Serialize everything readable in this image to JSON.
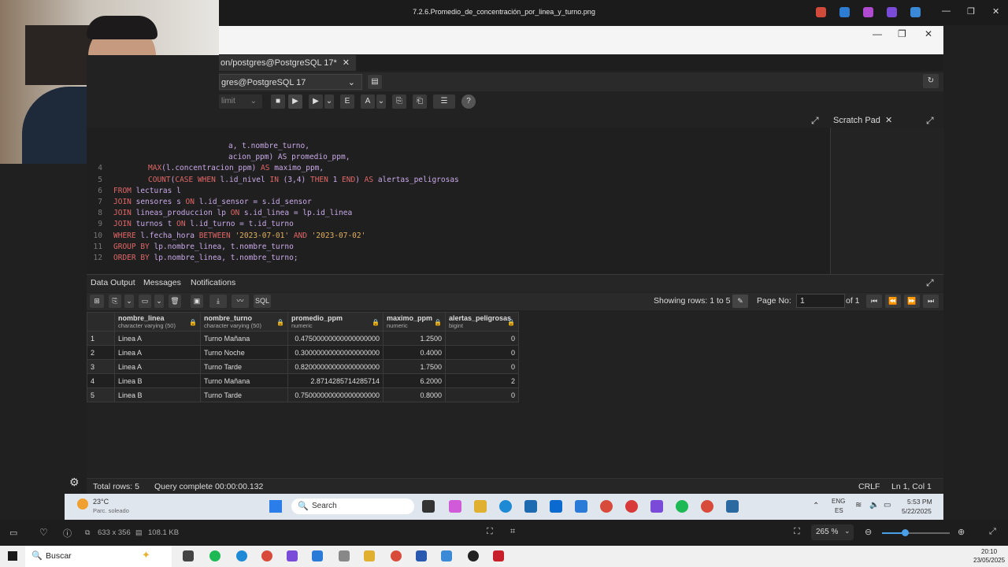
{
  "viewer": {
    "file_title": "7.2.6.Promedio_de_concentración_por_linea_y_turno.png",
    "dims": "633 x 356",
    "size": "108.1 KB",
    "zoom": "265 %"
  },
  "pg": {
    "tab_title": "on/postgres@PostgreSQL 17*",
    "tab_close": "✕",
    "connection": "gres@PostgreSQL 17",
    "limit_label": "limit",
    "scratch_pad": "Scratch Pad",
    "code_lines": [
      {
        "n": "",
        "parts": [
          [
            "txt",
            "a, t.nombre_turno,"
          ]
        ]
      },
      {
        "n": "",
        "parts": [
          [
            "txt",
            "acion_ppm) AS promedio_ppm,"
          ]
        ]
      },
      {
        "n": "4",
        "parts": [
          [
            "kw",
            "MAX"
          ],
          [
            "txt",
            "(l.concentracion_ppm) "
          ],
          [
            "kw",
            "AS"
          ],
          [
            "txt",
            " maximo_ppm,"
          ]
        ]
      },
      {
        "n": "5",
        "parts": [
          [
            "kw",
            "COUNT"
          ],
          [
            "txt",
            "("
          ],
          [
            "kw",
            "CASE WHEN"
          ],
          [
            "txt",
            " l.id_nivel "
          ],
          [
            "kw",
            "IN"
          ],
          [
            "txt",
            " (3,4) "
          ],
          [
            "kw",
            "THEN"
          ],
          [
            "txt",
            " 1 "
          ],
          [
            "kw",
            "END"
          ],
          [
            "txt",
            ") "
          ],
          [
            "kw",
            "AS"
          ],
          [
            "txt",
            " alertas_peligrosas"
          ]
        ]
      },
      {
        "n": "6",
        "parts": [
          [
            "kw",
            "FROM"
          ],
          [
            "txt",
            " lecturas l"
          ]
        ]
      },
      {
        "n": "7",
        "parts": [
          [
            "kw",
            "JOIN"
          ],
          [
            "txt",
            " sensores s "
          ],
          [
            "kw",
            "ON"
          ],
          [
            "txt",
            " l.id_sensor = s.id_sensor"
          ]
        ]
      },
      {
        "n": "8",
        "parts": [
          [
            "kw",
            "JOIN"
          ],
          [
            "txt",
            " lineas_produccion lp "
          ],
          [
            "kw",
            "ON"
          ],
          [
            "txt",
            " s.id_linea = lp.id_linea"
          ]
        ]
      },
      {
        "n": "9",
        "parts": [
          [
            "kw",
            "JOIN"
          ],
          [
            "txt",
            " turnos t "
          ],
          [
            "kw",
            "ON"
          ],
          [
            "txt",
            " l.id_turno = t.id_turno"
          ]
        ]
      },
      {
        "n": "10",
        "parts": [
          [
            "kw",
            "WHERE"
          ],
          [
            "txt",
            " l.fecha_hora "
          ],
          [
            "kw",
            "BETWEEN"
          ],
          [
            "str",
            " '2023-07-01' "
          ],
          [
            "kw",
            "AND"
          ],
          [
            "str",
            " '2023-07-02'"
          ]
        ]
      },
      {
        "n": "11",
        "parts": [
          [
            "kw",
            "GROUP BY"
          ],
          [
            "txt",
            " lp.nombre_linea, t.nombre_turno"
          ]
        ]
      },
      {
        "n": "12",
        "parts": [
          [
            "kw",
            "ORDER BY"
          ],
          [
            "txt",
            " lp.nombre_linea, t.nombre_turno;"
          ]
        ]
      }
    ],
    "out_tabs": [
      "Data Output",
      "Messages",
      "Notifications"
    ],
    "showing_rows": "Showing rows: 1 to 5",
    "page_no_label": "Page No:",
    "page_no": "1",
    "of_pages": "of 1",
    "columns": [
      {
        "name": "nombre_linea",
        "type": "character varying (50)"
      },
      {
        "name": "nombre_turno",
        "type": "character varying (50)"
      },
      {
        "name": "promedio_ppm",
        "type": "numeric"
      },
      {
        "name": "maximo_ppm",
        "type": "numeric"
      },
      {
        "name": "alertas_peligrosas",
        "type": "bigint"
      }
    ],
    "rows": [
      [
        "1",
        "Linea A",
        "Turno Mañana",
        "0.47500000000000000000",
        "1.2500",
        "0"
      ],
      [
        "2",
        "Linea A",
        "Turno Noche",
        "0.30000000000000000000",
        "0.4000",
        "0"
      ],
      [
        "3",
        "Linea A",
        "Turno Tarde",
        "0.82000000000000000000",
        "1.7500",
        "0"
      ],
      [
        "4",
        "Linea B",
        "Turno Mañana",
        "2.8714285714285714",
        "6.2000",
        "2"
      ],
      [
        "5",
        "Linea B",
        "Turno Tarde",
        "0.75000000000000000000",
        "0.8000",
        "0"
      ]
    ],
    "total_rows": "Total rows: 5",
    "query_complete": "Query complete 00:00:00.132",
    "crlf": "CRLF",
    "ln_col": "Ln 1, Col 1",
    "sql_btn": "SQL"
  },
  "inner_taskbar": {
    "weather_temp": "23°C",
    "weather_desc": "Parc. soleado",
    "search": "Search",
    "lang": "ENG",
    "lang2": "ES",
    "time": "5:53 PM",
    "date": "5/22/2025"
  },
  "os_taskbar": {
    "search": "Buscar",
    "time": "20:10",
    "date": "23/05/2025"
  }
}
